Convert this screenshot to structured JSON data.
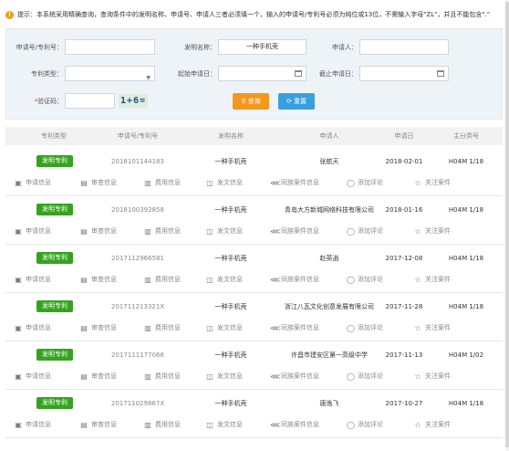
{
  "tip": {
    "icon": "!",
    "text": "提示：本系统采用精确查询，查询条件中的发明名称、申请号、申请人三者必须填一个，输入的申请号/专利号必须为纯位或13位，不需输入字母\"ZL\"，并且不能包含\".\""
  },
  "form": {
    "app_no_label": "申请号/专利号：",
    "app_no_value": "",
    "invention_name_label": "发明名称：",
    "invention_name_value": "一种手机壳",
    "applicant_label": "申请人：",
    "applicant_value": "",
    "type_label": "专利类型：",
    "type_value": "",
    "start_date_label": "起始申请日：",
    "start_date_value": "",
    "end_date_label": "截止申请日：",
    "end_date_value": "",
    "captcha_label": "验证码：",
    "captcha_required": "*",
    "captcha_value": "",
    "captcha_image_text": "1+6=",
    "search_button": "查询",
    "reset_button": "重置"
  },
  "table": {
    "headers": [
      "专利类型",
      "申请号/专利号",
      "发明名称",
      "申请人",
      "申请日",
      "主分类号"
    ],
    "actions": [
      "申请信息",
      "审查信息",
      "费用信息",
      "发文信息",
      "同族案件信息",
      "添加评论",
      "关注案件"
    ],
    "rows": [
      {
        "type": "发明专利",
        "app_no": "2018101144183",
        "name": "一种手机壳",
        "applicant": "张航天",
        "date": "2018-02-01",
        "class": "H04M 1/18"
      },
      {
        "type": "发明专利",
        "app_no": "2018100392858",
        "name": "一种手机壳",
        "applicant": "青岛大方新城网络科技有限公司",
        "date": "2018-01-16",
        "class": "H04M 1/18"
      },
      {
        "type": "发明专利",
        "app_no": "2017112966581",
        "name": "一种手机壳",
        "applicant": "赵英逍",
        "date": "2017-12-08",
        "class": "H04M 1/18"
      },
      {
        "type": "发明专利",
        "app_no": "201711213321X",
        "name": "一种手机壳",
        "applicant": "浙江八瓦文化创意发展有限公司",
        "date": "2017-11-28",
        "class": "H04M 1/18"
      },
      {
        "type": "发明专利",
        "app_no": "2017111177066",
        "name": "一种手机壳",
        "applicant": "许昌市建安区第一高级中学",
        "date": "2017-11-13",
        "class": "H04M 1/02"
      },
      {
        "type": "发明专利",
        "app_no": "201711029867X",
        "name": "一种手机壳",
        "applicant": "唐逸飞",
        "date": "2017-10-27",
        "class": "H04M 1/18"
      }
    ]
  },
  "icons": {
    "actions": [
      "image-icon",
      "document-icon",
      "fee-icon",
      "inbox-icon",
      "share-icon",
      "comment-icon",
      "star-icon"
    ]
  },
  "colors": {
    "badge": "#36a31f",
    "search_button": "#f5971f",
    "reset_button": "#39a0e0",
    "tip_icon": "#f39a1e"
  }
}
